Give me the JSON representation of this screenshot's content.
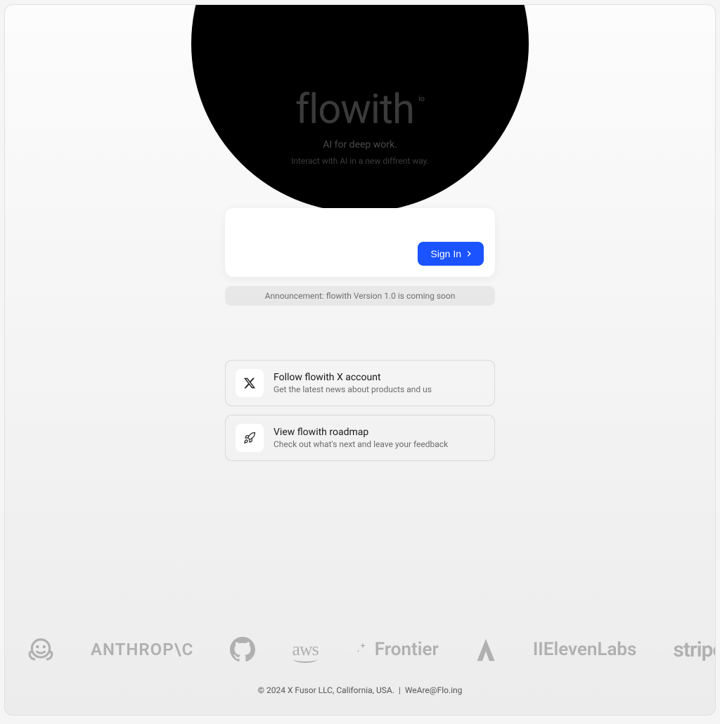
{
  "hero": {
    "logo": "flowith",
    "badge": "io",
    "tagline1": "AI for deep work.",
    "tagline2": "Interact with AI in a new diffrent way."
  },
  "auth": {
    "signin_label": "Sign In"
  },
  "announcement": "Announcement: flowith Version 1.0 is coming soon",
  "links": [
    {
      "icon": "x-logo",
      "title": "Follow flowith X account",
      "subtitle": "Get the latest news about products and us"
    },
    {
      "icon": "rocket",
      "title": "View flowith roadmap",
      "subtitle": "Check out what's next and leave your feedback"
    }
  ],
  "partners": {
    "p0": "ANTHROP\\C",
    "p1": "",
    "p2": "aws",
    "p3": "Frontier",
    "p4": "",
    "p5": "IIElevenLabs",
    "p6": "stripe"
  },
  "footer": {
    "copyright": "© 2024 X Fusor LLC, California, USA.",
    "separator": "|",
    "email": "WeAre@Flo.ing"
  }
}
